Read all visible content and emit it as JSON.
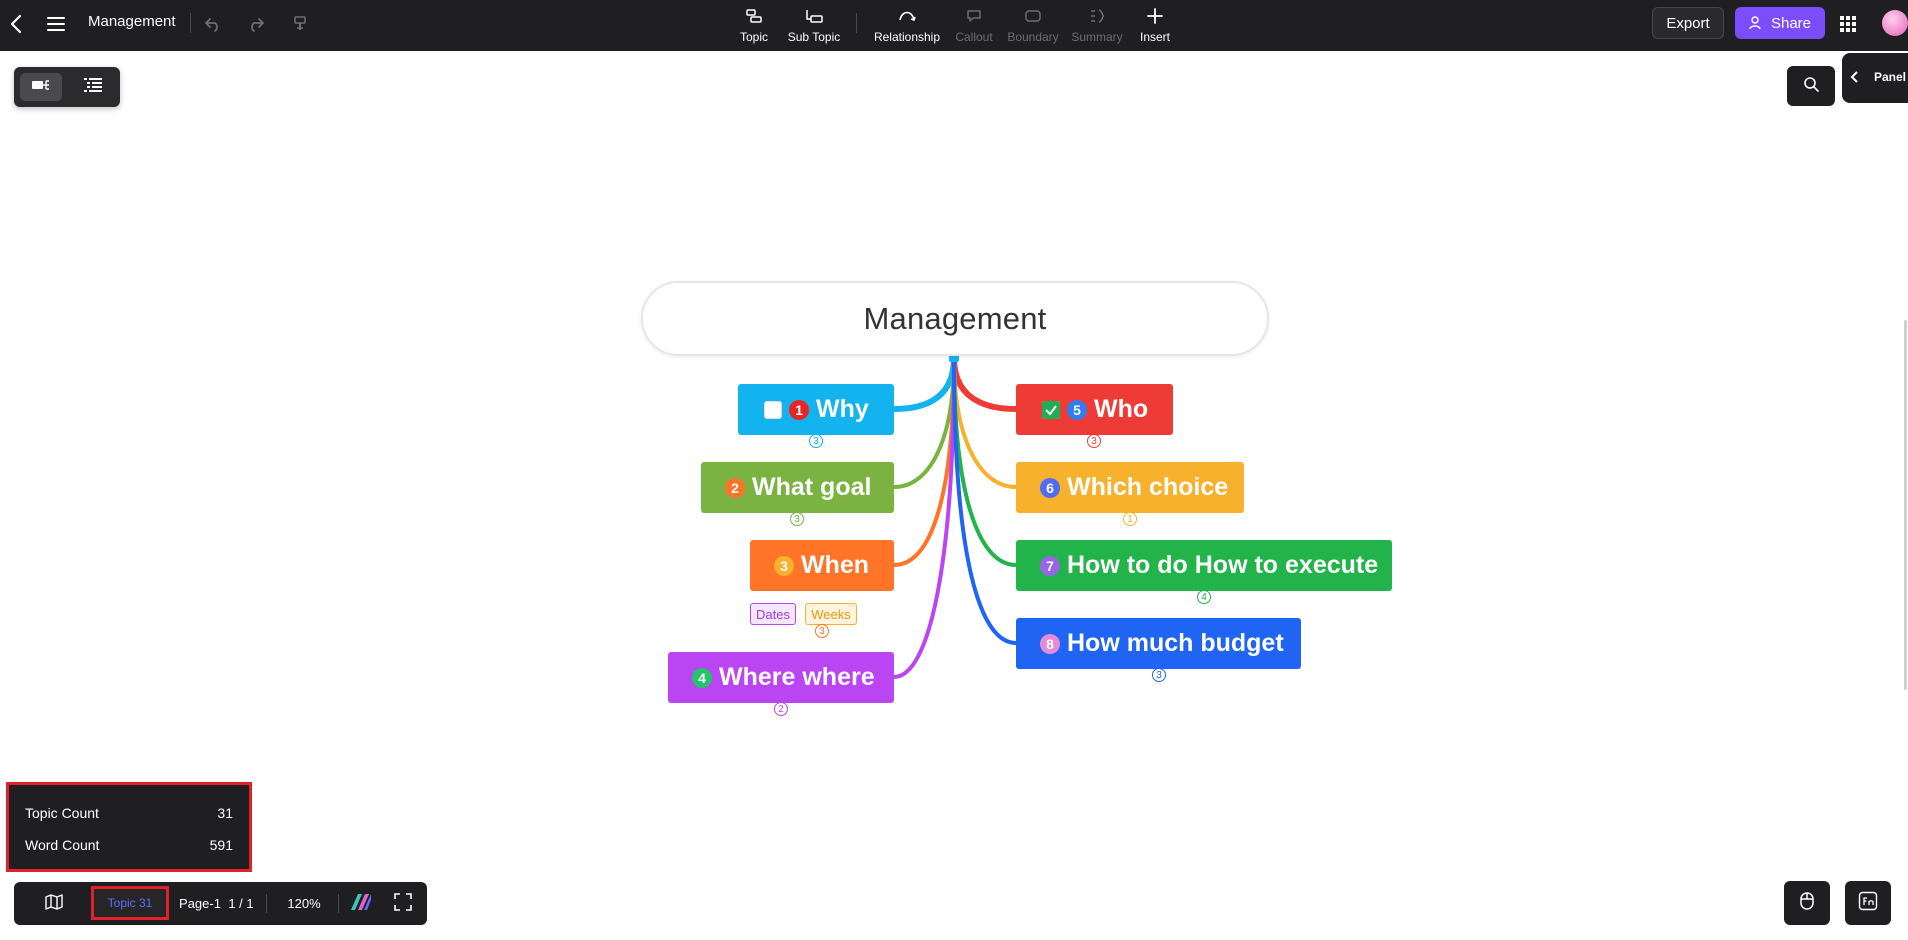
{
  "header": {
    "doc_title": "Management",
    "tools": [
      {
        "label": "Topic",
        "icon": "topic-icon",
        "enabled": true
      },
      {
        "label": "Sub Topic",
        "icon": "subtopic-icon",
        "enabled": true
      },
      {
        "label": "Relationship",
        "icon": "relationship-icon",
        "enabled": true
      },
      {
        "label": "Callout",
        "icon": "callout-icon",
        "enabled": false
      },
      {
        "label": "Boundary",
        "icon": "boundary-icon",
        "enabled": false
      },
      {
        "label": "Summary",
        "icon": "summary-icon",
        "enabled": false
      },
      {
        "label": "Insert",
        "icon": "plus-icon",
        "enabled": true
      }
    ],
    "export_label": "Export",
    "share_label": "Share"
  },
  "side": {
    "panel_label": "Panel"
  },
  "mindmap": {
    "root": "Management",
    "left_topics": [
      {
        "num": "1",
        "label": "Why",
        "color": "#12b3ef",
        "count": "3",
        "checkbox": "empty"
      },
      {
        "num": "2",
        "label": "What goal",
        "color": "#7ab342",
        "count": "3"
      },
      {
        "num": "3",
        "label": "When",
        "color": "#ff7426",
        "count": "3",
        "tags": [
          "Dates",
          "Weeks"
        ]
      },
      {
        "num": "4",
        "label": "Where where",
        "color": "#b946f2",
        "count": "2"
      }
    ],
    "right_topics": [
      {
        "num": "5",
        "label": "Who",
        "color": "#ef3b36",
        "count": "3",
        "checkbox": "checked"
      },
      {
        "num": "6",
        "label": "Which choice",
        "color": "#f8b12d",
        "count": "1"
      },
      {
        "num": "7",
        "label": "How to do How to execute",
        "color": "#23b34b",
        "count": "4"
      },
      {
        "num": "8",
        "label": "How much budget",
        "color": "#1f64f2",
        "count": "3"
      }
    ]
  },
  "stats": {
    "topic_count_label": "Topic Count",
    "topic_count": "31",
    "word_count_label": "Word Count",
    "word_count": "591"
  },
  "bottom": {
    "topic_chip": "Topic 31",
    "page_label": "Page-1",
    "page_index": "1 / 1",
    "zoom": "120%"
  }
}
